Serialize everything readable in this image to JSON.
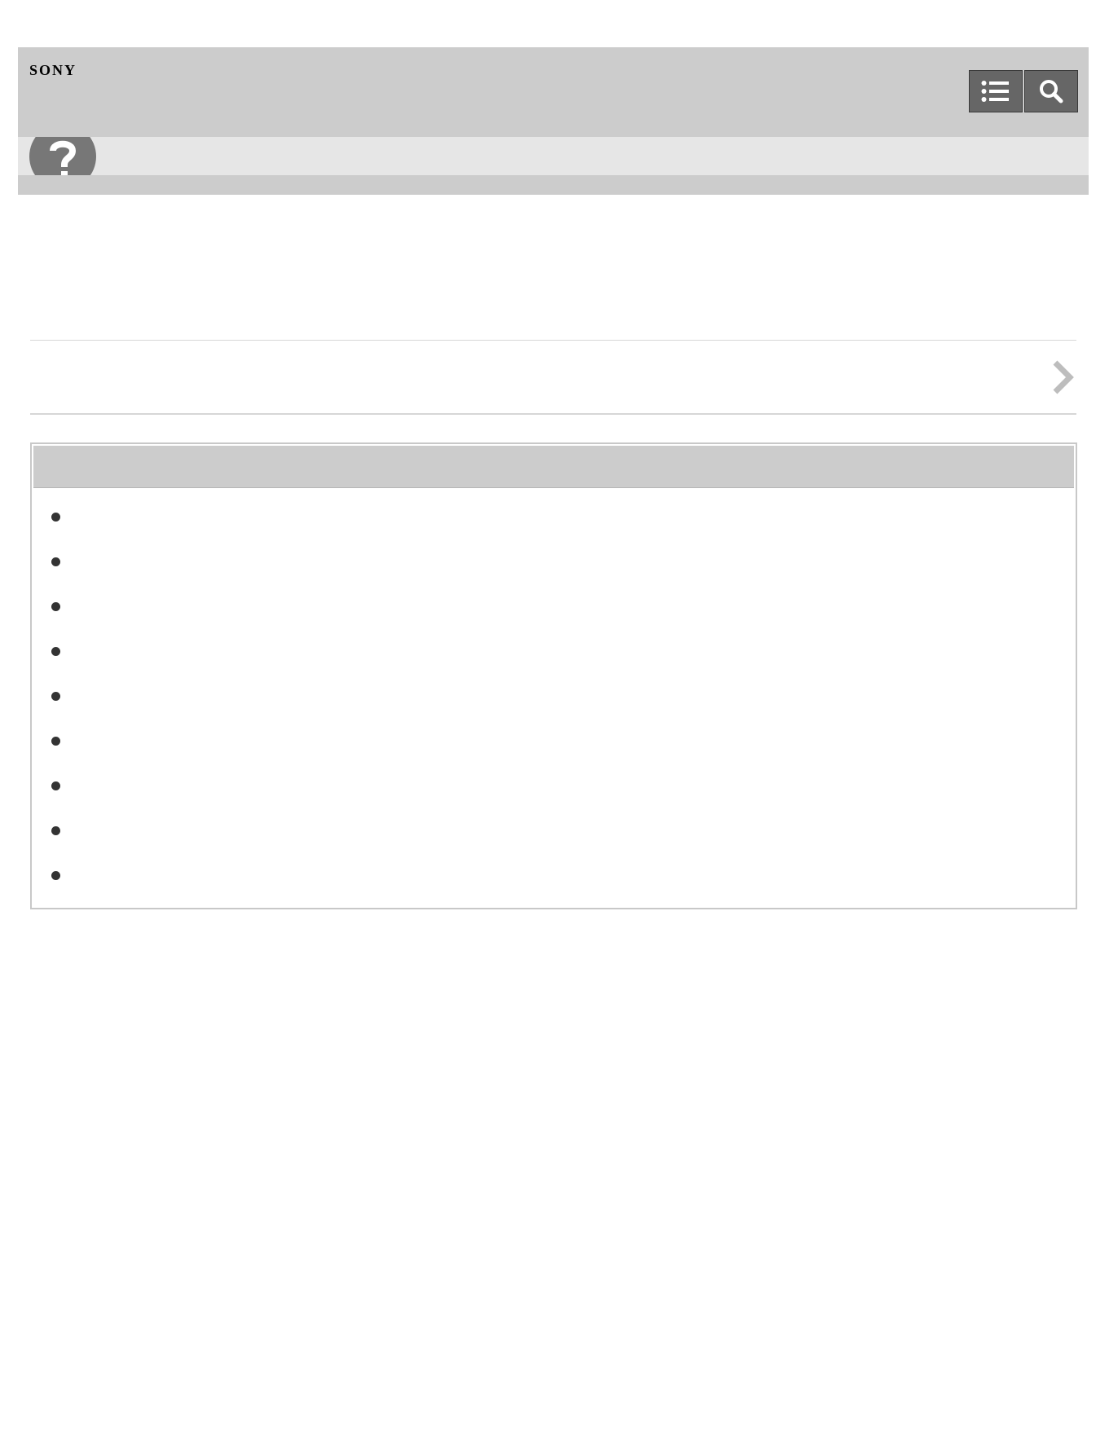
{
  "header": {
    "brand": "SONY",
    "toc_icon": "list-icon",
    "search_icon": "search-icon"
  },
  "subheader": {
    "icon": "question-mark-icon"
  },
  "nav": {
    "chevron_icon": "chevron-right-icon"
  },
  "panel": {
    "items": [
      "",
      "",
      "",
      "",
      "",
      "",
      "",
      "",
      ""
    ]
  },
  "colors": {
    "header_band": "#cccccc",
    "subheader_band": "#e6e6e6",
    "button": "#666666",
    "help_icon": "#777777",
    "bullet": "#333333",
    "chevron": "#bdbdbd"
  }
}
